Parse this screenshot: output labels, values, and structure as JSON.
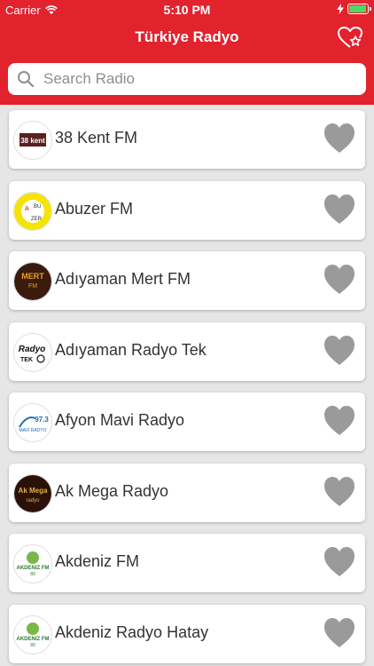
{
  "status_bar": {
    "carrier": "Carrier",
    "time": "5:10 PM"
  },
  "header": {
    "title": "Türkiye Radyo",
    "favorites_icon": "heart-star-icon"
  },
  "search": {
    "placeholder": "Search Radio",
    "value": ""
  },
  "colors": {
    "header_red": "#e2222d",
    "heart_gray": "#9a9a9a",
    "background": "#e6e6e6"
  },
  "stations": [
    {
      "name": "38 Kent FM",
      "logo_text": "38 kent"
    },
    {
      "name": "Abuzer FM",
      "logo_text": "ABUZER"
    },
    {
      "name": "Adıyaman Mert FM",
      "logo_text": "MERT FM"
    },
    {
      "name": "Adıyaman Radyo Tek",
      "logo_text": "Radyo TEK"
    },
    {
      "name": "Afyon Mavi Radyo",
      "logo_text": "97.3 MAVİ RADYO"
    },
    {
      "name": "Ak Mega Radyo",
      "logo_text": "Ak Mega"
    },
    {
      "name": "Akdeniz FM",
      "logo_text": "AKDENIZ FM"
    },
    {
      "name": "Akdeniz Radyo Hatay",
      "logo_text": "AKDENIZ FM"
    }
  ]
}
